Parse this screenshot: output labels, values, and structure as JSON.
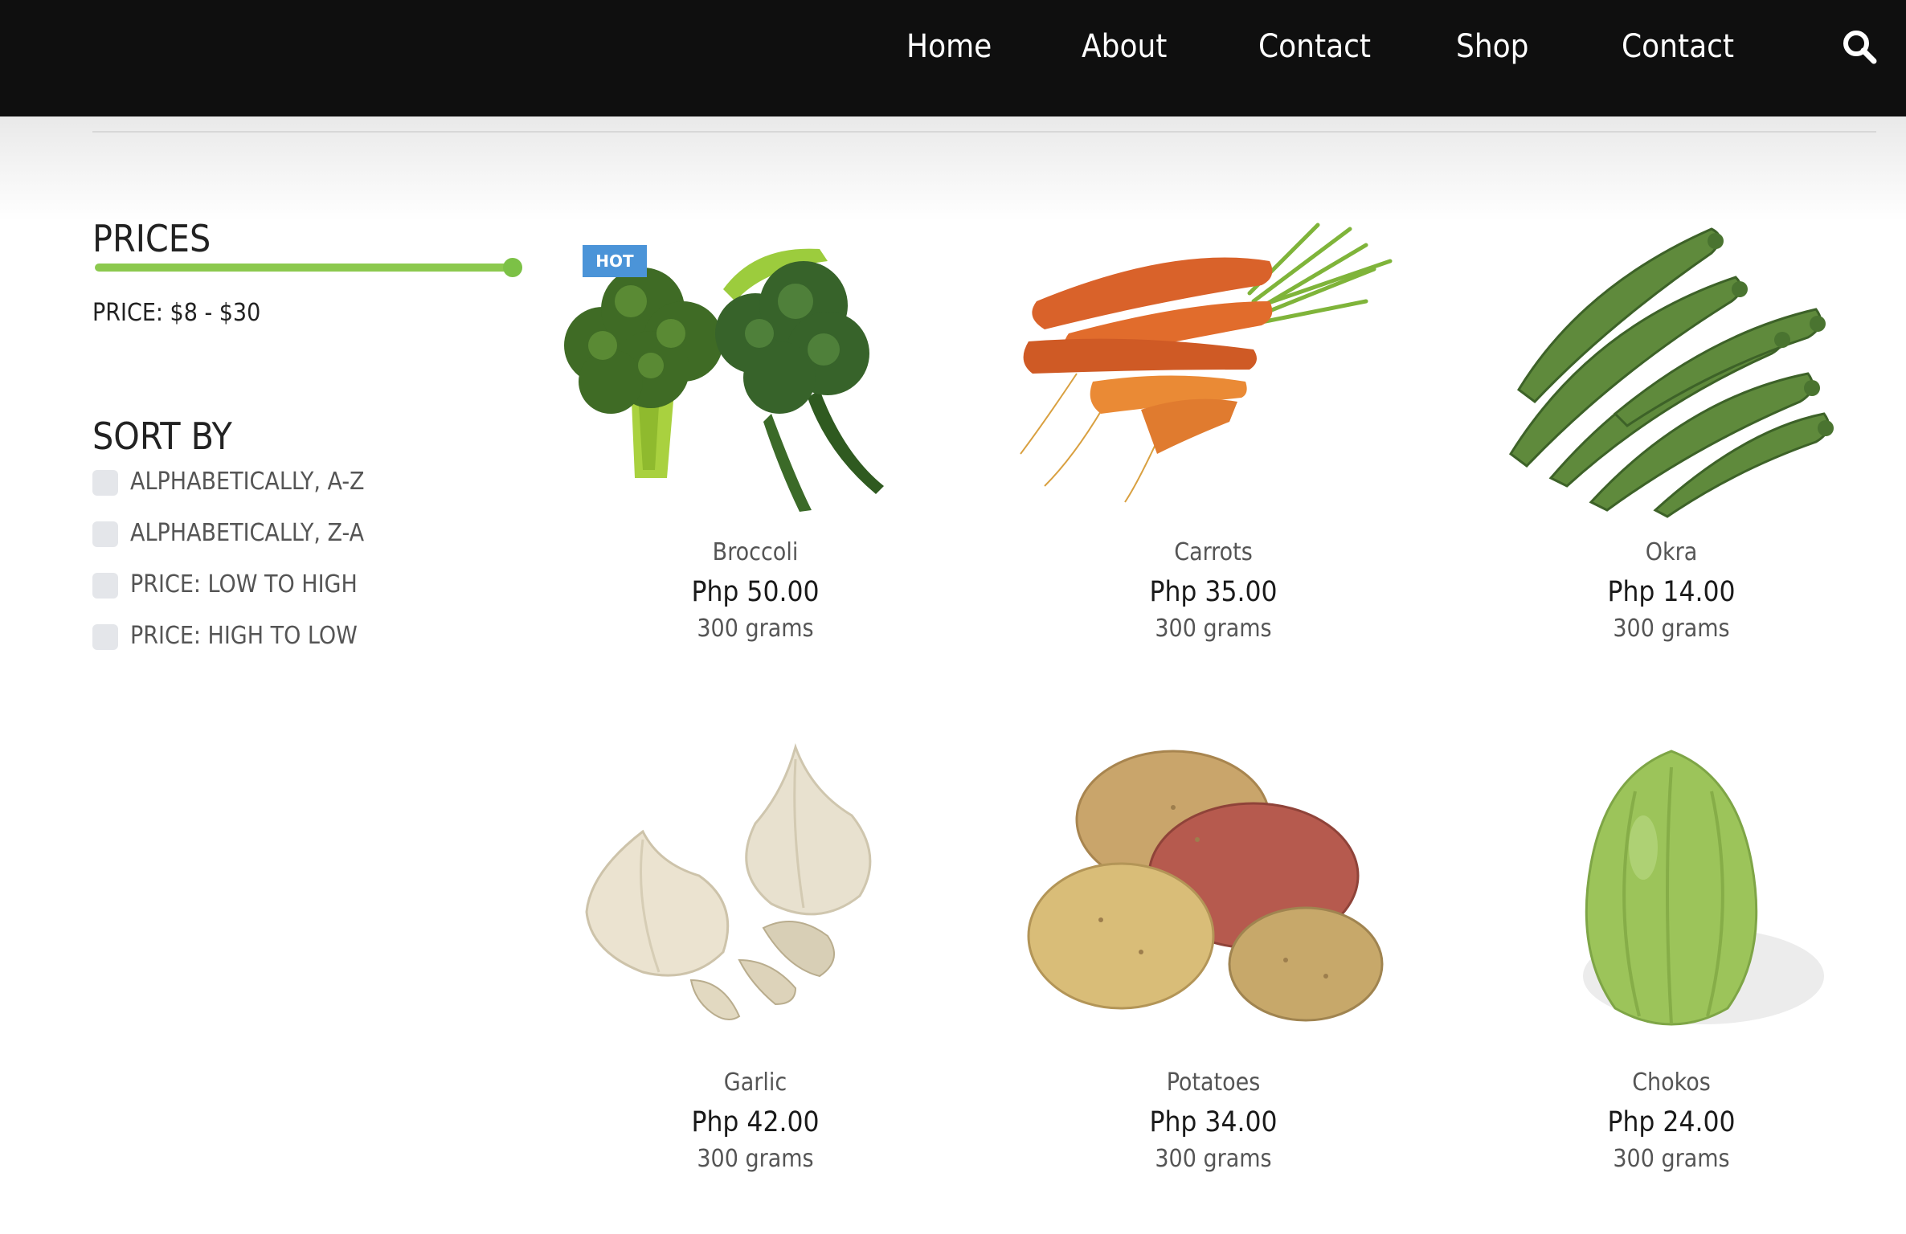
{
  "nav": {
    "items": [
      "Home",
      "About",
      "Contact",
      "Shop",
      "Contact"
    ],
    "search_icon": "search-icon"
  },
  "sidebar": {
    "prices_heading": "PRICES",
    "price_range_label": "PRICE: $8 - $30",
    "sort_heading": "SORT BY",
    "sort_options": [
      "ALPHABETICALLY, A-Z",
      "ALPHABETICALLY, Z-A",
      "PRICE: LOW TO HIGH",
      "PRICE: HIGH TO LOW"
    ]
  },
  "products": [
    {
      "name": "Broccoli",
      "price": "Php 50.00",
      "weight": "300 grams",
      "badge": "HOT",
      "image": "broccoli"
    },
    {
      "name": "Carrots",
      "price": "Php 35.00",
      "weight": "300 grams",
      "image": "carrots"
    },
    {
      "name": "Okra",
      "price": "Php 14.00",
      "weight": "300 grams",
      "image": "okra"
    },
    {
      "name": "Garlic",
      "price": "Php 42.00",
      "weight": "300 grams",
      "image": "garlic"
    },
    {
      "name": "Potatoes",
      "price": "Php 34.00",
      "weight": "300 grams",
      "image": "potatoes"
    },
    {
      "name": "Chokos",
      "price": "Php 24.00",
      "weight": "300 grams",
      "image": "chayote"
    }
  ],
  "colors": {
    "navbar": "#0f0f0f",
    "slider": "#7cc146",
    "hot_badge": "#4b94d8"
  }
}
